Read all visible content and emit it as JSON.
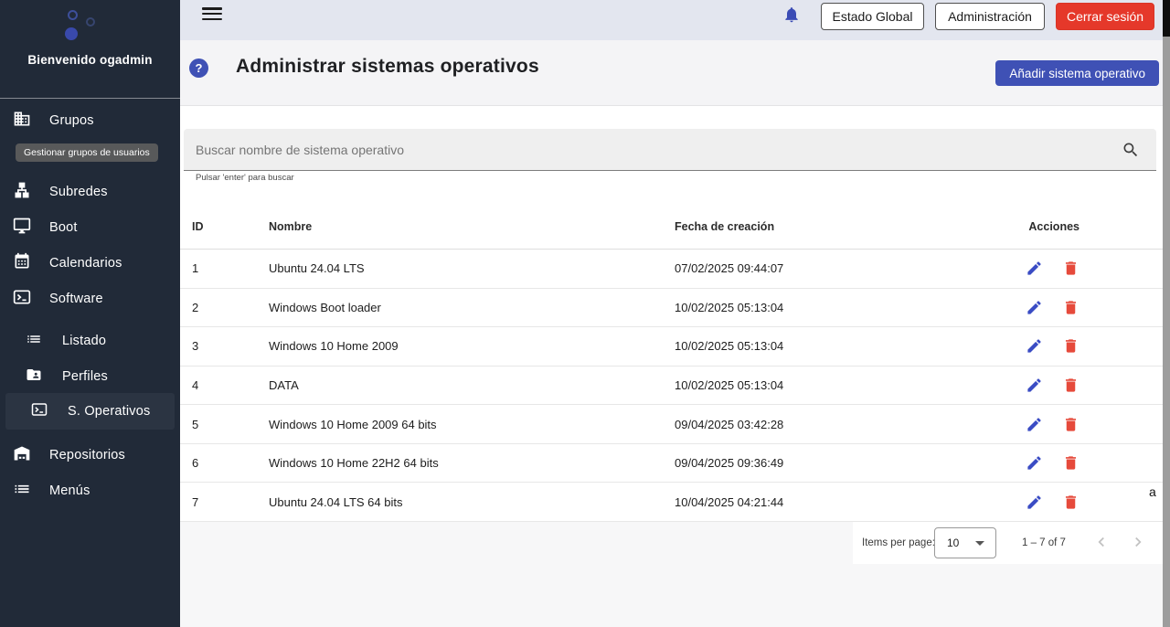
{
  "sidebar": {
    "welcome": "Bienvenido ogadmin",
    "tooltip": "Gestionar grupos de usuarios",
    "items": [
      {
        "label": "Grupos",
        "icon": "building-icon"
      },
      {
        "label": "Subredes",
        "icon": "network-icon"
      },
      {
        "label": "Boot",
        "icon": "monitor-icon"
      },
      {
        "label": "Calendarios",
        "icon": "calendar-icon"
      },
      {
        "label": "Software",
        "icon": "terminal-icon"
      },
      {
        "label": "Listado",
        "icon": "list-icon",
        "indent": true
      },
      {
        "label": "Perfiles",
        "icon": "folder-user-icon",
        "indent": true
      },
      {
        "label": "S. Operativos",
        "icon": "terminal-icon",
        "indent": true,
        "selected": true
      },
      {
        "label": "Repositorios",
        "icon": "warehouse-icon"
      },
      {
        "label": "Menús",
        "icon": "list-icon"
      }
    ]
  },
  "toolbar": {
    "bell_icon": "notifications-icon",
    "estado_global": "Estado Global",
    "administracion": "Administración",
    "cerrar_sesion": "Cerrar sesión"
  },
  "header": {
    "help_icon": "?",
    "title": "Administrar sistemas operativos",
    "add_button": "Añadir sistema operativo"
  },
  "search": {
    "placeholder": "Buscar nombre de sistema operativo",
    "hint": "Pulsar 'enter' para buscar",
    "icon": "search-icon"
  },
  "table": {
    "columns": {
      "id": "ID",
      "name": "Nombre",
      "date": "Fecha de creación",
      "actions": "Acciones"
    },
    "row_action_icons": [
      "edit-pencil-icon",
      "delete-trash-icon"
    ],
    "rows": [
      {
        "id": "1",
        "name": "Ubuntu 24.04 LTS",
        "date": "07/02/2025 09:44:07"
      },
      {
        "id": "2",
        "name": "Windows Boot loader",
        "date": "10/02/2025 05:13:04"
      },
      {
        "id": "3",
        "name": "Windows 10 Home 2009",
        "date": "10/02/2025 05:13:04"
      },
      {
        "id": "4",
        "name": "DATA",
        "date": "10/02/2025 05:13:04"
      },
      {
        "id": "5",
        "name": "Windows 10 Home 2009 64 bits",
        "date": "09/04/2025 03:42:28"
      },
      {
        "id": "6",
        "name": "Windows 10 Home 22H2 64 bits",
        "date": "09/04/2025 09:36:49"
      },
      {
        "id": "7",
        "name": "Ubuntu 24.04 LTS 64 bits",
        "date": "10/04/2025 04:21:44"
      }
    ]
  },
  "paginator": {
    "items_per_page_label": "Items per page:",
    "page_size": "10",
    "range": "1 – 7 of 7"
  },
  "misc": {
    "clipped_text": "a"
  },
  "colors": {
    "accent": "#3f51b5",
    "danger": "#e5382a",
    "sidebar_bg": "#212a38",
    "toolbar_bg": "#e3e6ef",
    "edit_icon": "#3a4cc4",
    "delete_icon": "#e64a3b"
  }
}
